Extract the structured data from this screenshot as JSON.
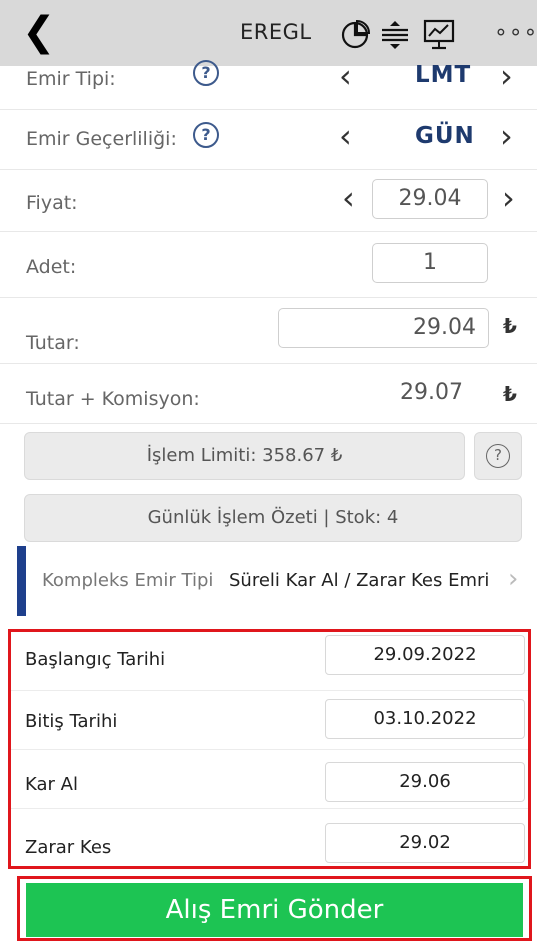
{
  "header": {
    "back_icon": "chevron-left-icon",
    "symbol": "EREGL",
    "icons": [
      "pie-chart-icon",
      "order-depth-icon",
      "presentation-chart-icon"
    ],
    "more": "∘∘∘"
  },
  "order": {
    "order_type": {
      "label": "Emir Tipi:",
      "value": "LMT"
    },
    "validity": {
      "label": "Emir Geçerliliği:",
      "value": "GÜN"
    },
    "price": {
      "label": "Fiyat:",
      "value": "29.04"
    },
    "quantity": {
      "label": "Adet:",
      "value": "1"
    },
    "amount": {
      "label": "Tutar:",
      "value": "29.04",
      "currency": "₺"
    },
    "amount_commission": {
      "label": "Tutar + Komisyon:",
      "value": "29.07",
      "currency": "₺"
    }
  },
  "limit_button": "İşlem Limiti: 358.67 ₺",
  "summary_button": "Günlük İşlem Özeti | Stok: 4",
  "complex": {
    "label": "Kompleks Emir Tipi",
    "value": "Süreli Kar Al / Zarar Kes Emri"
  },
  "dates": {
    "start": {
      "label": "Başlangıç Tarihi",
      "value": "29.09.2022"
    },
    "end": {
      "label": "Bitiş Tarihi",
      "value": "03.10.2022"
    },
    "take_profit": {
      "label": "Kar Al",
      "value": "29.06"
    },
    "stop_loss": {
      "label": "Zarar Kes",
      "value": "29.02"
    }
  },
  "send_button": "Alış Emri Gönder",
  "colors": {
    "accent": "#1e3a6e",
    "send": "#1dc453",
    "highlight": "#e0161c"
  }
}
